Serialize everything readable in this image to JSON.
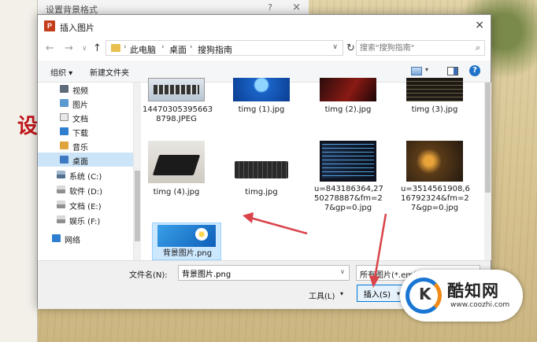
{
  "background": {
    "outer_title": "设置背景格式",
    "outer_help": "?",
    "outer_close": "×",
    "slide_char": "设"
  },
  "dialog": {
    "app_icon": "P",
    "title": "插入图片",
    "close": "×"
  },
  "nav": {
    "back": "←",
    "forward": "→",
    "recent": "∨",
    "up": "↑",
    "breadcrumb": [
      "此电脑",
      "桌面",
      "搜狗指南"
    ],
    "breadcrumb_sep": "›",
    "dropdown": "∨",
    "refresh": "↻",
    "search_placeholder": "搜索\"搜狗指南\"",
    "search_icon": "⌕"
  },
  "toolbar": {
    "organize": "组织 ▾",
    "new_folder": "新建文件夹",
    "view_dropdown": "▾",
    "help": "?"
  },
  "sidebar": {
    "items": [
      {
        "label": "视频",
        "icon": "video-icon"
      },
      {
        "label": "图片",
        "icon": "pictures-icon"
      },
      {
        "label": "文档",
        "icon": "documents-icon"
      },
      {
        "label": "下载",
        "icon": "downloads-icon"
      },
      {
        "label": "音乐",
        "icon": "music-icon"
      },
      {
        "label": "桌面",
        "icon": "desktop-icon"
      },
      {
        "label": "系统 (C:)",
        "icon": "drive-c-icon"
      },
      {
        "label": "软件 (D:)",
        "icon": "drive-d-icon"
      },
      {
        "label": "文档 (E:)",
        "icon": "drive-e-icon"
      },
      {
        "label": "娱乐 (F:)",
        "icon": "drive-f-icon"
      },
      {
        "label": "网络",
        "icon": "network-icon"
      }
    ],
    "selected": "桌面"
  },
  "files": [
    {
      "name": "14470305395663\n8798.JPEG",
      "thumb": "keyboard-screenshot"
    },
    {
      "name": "timg (1).jpg",
      "thumb": "blue-logo"
    },
    {
      "name": "timg (2).jpg",
      "thumb": "dark-red"
    },
    {
      "name": "timg (3).jpg",
      "thumb": "dark-text"
    },
    {
      "name": "timg (4).jpg",
      "thumb": "laptop"
    },
    {
      "name": "timg.jpg",
      "thumb": "keyboard"
    },
    {
      "name": "u=843186364,27\n50278887&fm=2\n7&gp=0.jpg",
      "thumb": "code-screen"
    },
    {
      "name": "u=3514561908,6\n16792324&fm=2\n7&gp=0.jpg",
      "thumb": "game-art"
    },
    {
      "name": "背景图片.png",
      "thumb": "blue-flower"
    }
  ],
  "selected_file": "背景图片.png",
  "bottom": {
    "filename_label": "文件名(N):",
    "filename_value": "背景图片.png",
    "filter_value": "所有图片(*.emf;*.wmf;*.jpg;*.jp",
    "tools_label": "工具(L)",
    "tools_dropdown": "▾",
    "insert_label": "插入(S)",
    "insert_dropdown": "▾"
  },
  "watermark": {
    "logo_letter": "K",
    "text": "酷知网",
    "url": "www.coozhi.com"
  },
  "colors": {
    "accent": "#0078d7",
    "selection": "#cce8ff",
    "annotation": "#d9434a"
  }
}
